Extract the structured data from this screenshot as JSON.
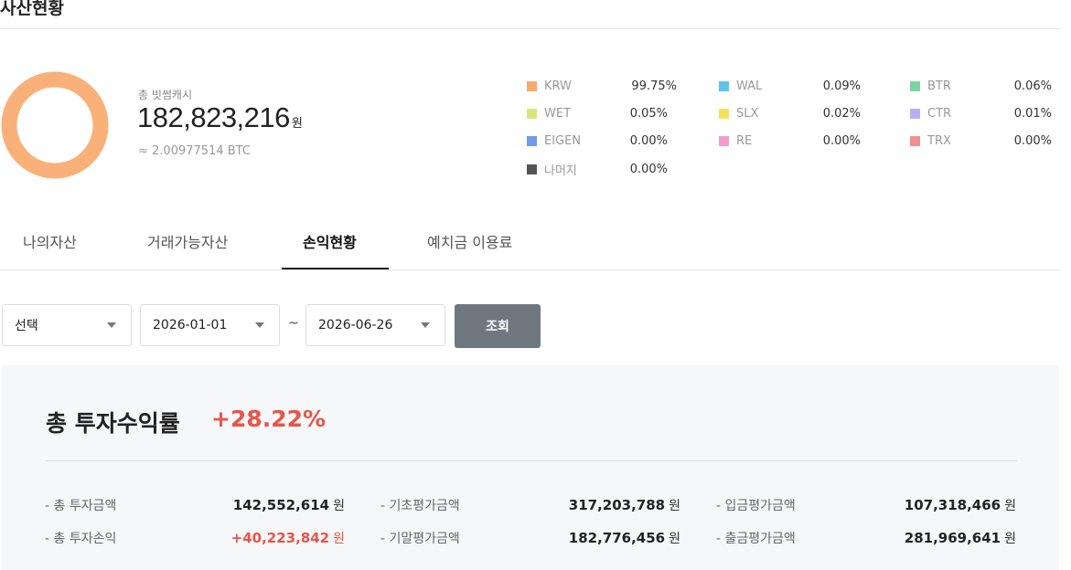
{
  "page": {
    "title": "사산현황"
  },
  "summary": {
    "label": "총 빗썸캐시",
    "amount": "182,823,216",
    "unit": "원",
    "btc": "≈ 2.00977514 BTC"
  },
  "donut": {
    "color": "#f9b179",
    "fraction": 0.9975
  },
  "legend": [
    {
      "name": "KRW",
      "pct": "99.75%",
      "color": "#f7a86b"
    },
    {
      "name": "WAL",
      "pct": "0.09%",
      "color": "#5cc3ec"
    },
    {
      "name": "BTR",
      "pct": "0.06%",
      "color": "#7ad4a0"
    },
    {
      "name": "WET",
      "pct": "0.05%",
      "color": "#dbe57e"
    },
    {
      "name": "SLX",
      "pct": "0.02%",
      "color": "#f6e25a"
    },
    {
      "name": "CTR",
      "pct": "0.01%",
      "color": "#b8b0f0"
    },
    {
      "name": "EIGEN",
      "pct": "0.00%",
      "color": "#6f9ae8"
    },
    {
      "name": "RE",
      "pct": "0.00%",
      "color": "#f49ccc"
    },
    {
      "name": "TRX",
      "pct": "0.00%",
      "color": "#f28f8f"
    },
    {
      "name": "나머지",
      "pct": "0.00%",
      "color": "#555555"
    }
  ],
  "tabs": [
    {
      "label": "나의자산"
    },
    {
      "label": "거래가능자산"
    },
    {
      "label": "손익현황"
    },
    {
      "label": "예치금 이용료"
    }
  ],
  "filters": {
    "type_value": "선택",
    "start_date": "2026-01-01",
    "separator": "~",
    "end_date": "2026-06-26",
    "search_label": "조회"
  },
  "profit": {
    "rate_label": "총 투자수익률",
    "rate_value": "+28.22%",
    "unit": "원",
    "rows": [
      {
        "label": "- 총 투자금액",
        "value": "142,552,614"
      },
      {
        "label": "- 기초평가금액",
        "value": "317,203,788"
      },
      {
        "label": "- 입금평가금액",
        "value": "107,318,466"
      },
      {
        "label": "- 총 투자손익",
        "value": "+40,223,842"
      },
      {
        "label": "- 기말평가금액",
        "value": "182,776,456"
      },
      {
        "label": "- 출금평가금액",
        "value": "281,969,641"
      }
    ]
  },
  "colors": {
    "accent_red": "#e8554a",
    "button_gray": "#6f7880"
  }
}
